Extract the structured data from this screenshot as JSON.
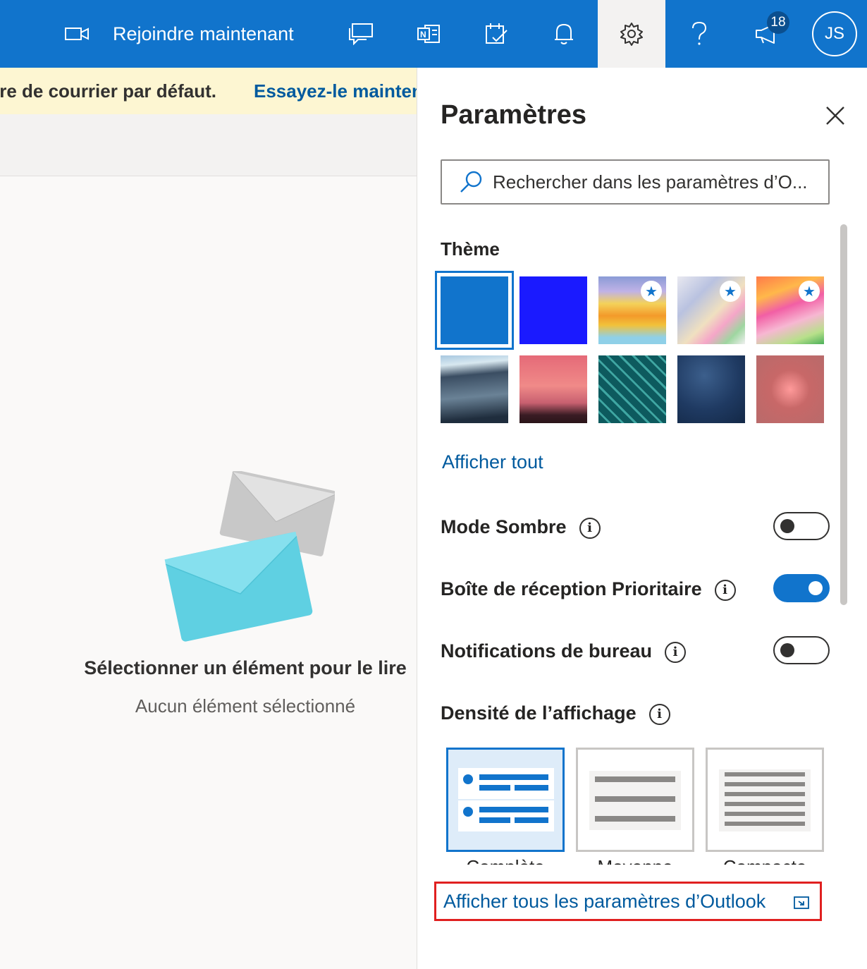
{
  "topbar": {
    "join_label": "Rejoindre maintenant",
    "badge_count": "18",
    "avatar_initials": "JS",
    "icons": [
      "video-icon",
      "chat-icon",
      "onenote-icon",
      "tasks-icon",
      "bell-icon",
      "settings-icon",
      "help-icon",
      "announcement-icon"
    ]
  },
  "notice": {
    "text": "ire de courrier par défaut.",
    "link": "Essayez-le mainten"
  },
  "reading_pane": {
    "title": "Sélectionner un élément pour le lire",
    "subtitle": "Aucun élément sélectionné"
  },
  "settings": {
    "title": "Paramètres",
    "search_placeholder": "Rechercher dans les paramètres d’O...",
    "theme_label": "Thème",
    "show_all": "Afficher tout",
    "dark_mode": {
      "label": "Mode Sombre",
      "on": false
    },
    "focused_inbox": {
      "label": "Boîte de réception Prioritaire",
      "on": true
    },
    "desktop_notifications": {
      "label": "Notifications de bureau",
      "on": false
    },
    "density": {
      "label": "Densité de l’affichage",
      "options": [
        "Complète",
        "Moyenne",
        "Compacte"
      ],
      "selected": "Complète"
    },
    "all_settings_link": "Afficher tous les paramètres d’Outlook"
  },
  "colors": {
    "brand": "#1174cc",
    "link": "#005a9e",
    "highlight_border": "#e02020",
    "notice_bg": "#fdf6d2"
  }
}
